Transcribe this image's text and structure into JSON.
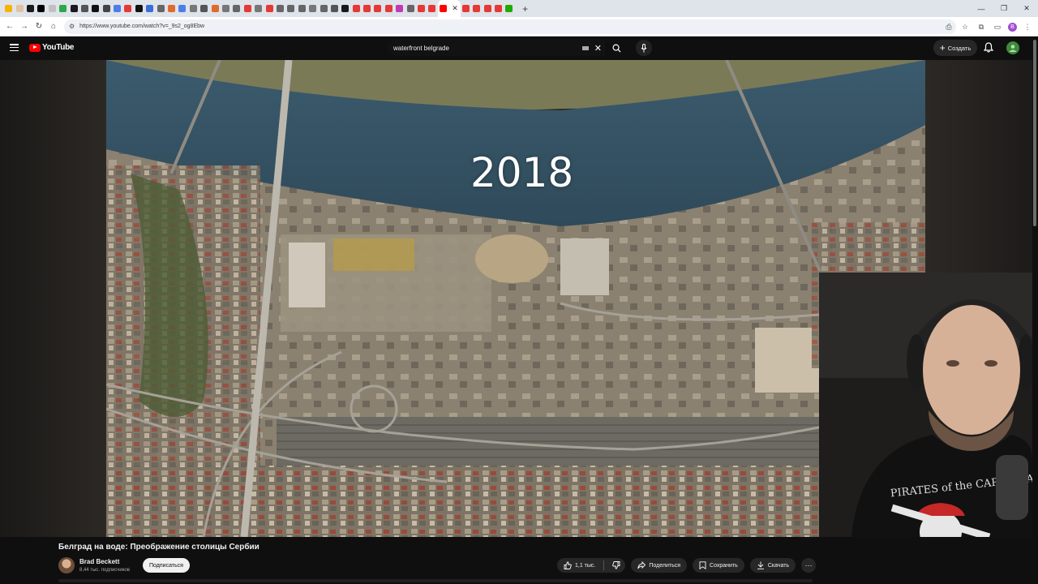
{
  "browser": {
    "tabs": [
      {
        "color": "#f5b400"
      },
      {
        "color": "#e0c3a0"
      },
      {
        "color": "#1a1a1a"
      },
      {
        "color": "#000000"
      },
      {
        "color": "#c0c0c0"
      },
      {
        "color": "#2ba84a"
      },
      {
        "color": "#1a1a1a"
      },
      {
        "color": "#555555"
      },
      {
        "color": "#111111"
      },
      {
        "color": "#444444"
      },
      {
        "color": "#4d7ee8"
      },
      {
        "color": "#e53935"
      },
      {
        "color": "#111111"
      },
      {
        "color": "#3b6fd8"
      },
      {
        "color": "#666666"
      },
      {
        "color": "#e06a2c"
      },
      {
        "color": "#4d7ee8"
      },
      {
        "color": "#777777"
      },
      {
        "color": "#555555"
      },
      {
        "color": "#e06a2c"
      },
      {
        "color": "#777777"
      },
      {
        "color": "#666666"
      },
      {
        "color": "#e53935"
      },
      {
        "color": "#777777"
      },
      {
        "color": "#e53935"
      },
      {
        "color": "#666666"
      },
      {
        "color": "#666666"
      },
      {
        "color": "#666666"
      },
      {
        "color": "#777777"
      },
      {
        "color": "#666666"
      },
      {
        "color": "#555555"
      },
      {
        "color": "#1a1a1a"
      },
      {
        "color": "#e53935"
      },
      {
        "color": "#e53935"
      },
      {
        "color": "#e53935"
      },
      {
        "color": "#e53935"
      },
      {
        "color": "#c03ab5"
      },
      {
        "color": "#666666"
      },
      {
        "color": "#e53935"
      },
      {
        "color": "#e53935"
      }
    ],
    "active_tab_index": 40,
    "extra_tabs_after": [
      {
        "color": "#e53935"
      },
      {
        "color": "#e53935"
      },
      {
        "color": "#e53935"
      },
      {
        "color": "#e53935"
      },
      {
        "color": "#1faa00"
      }
    ],
    "url": "https://www.youtube.com/watch?v=_9s2_og8Ebw",
    "profile_initial": "B"
  },
  "masthead": {
    "logo_text": "YouTube",
    "search_query": "waterfront belgrade",
    "create_label": "Создать"
  },
  "video": {
    "overlay_year": "2018"
  },
  "info": {
    "title": "Белград на воде: Преображение столицы Сербии",
    "channel_name": "Brad Beckett",
    "subscribers": "8,44 тыс. подписчиков",
    "subscribe_label": "Подписаться",
    "like_count": "1,1 тыс.",
    "share_label": "Поделиться",
    "save_label": "Сохранить",
    "download_label": "Скачать",
    "more_label": "···"
  }
}
